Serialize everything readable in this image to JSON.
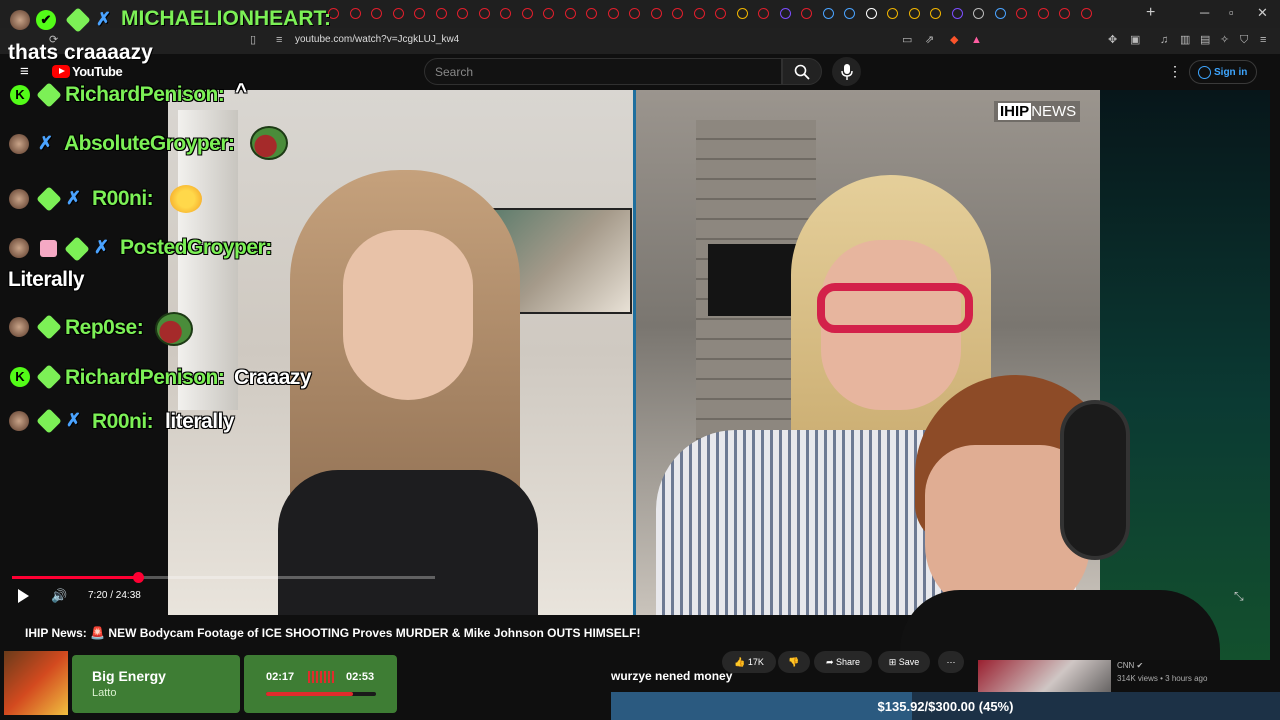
{
  "browser": {
    "url": "youtube.com/watch?v=JcgkLUJ_kw4",
    "new_tab": "+",
    "tab_colors": [
      "#e01f2c",
      "#e01f2c",
      "#e01f2c",
      "#e01f2c",
      "#e01f2c",
      "#e01f2c",
      "#e01f2c",
      "#e01f2c",
      "#e01f2c",
      "#e01f2c",
      "#e01f2c",
      "#e01f2c",
      "#e01f2c",
      "#e01f2c",
      "#e01f2c",
      "#e01f2c",
      "#e01f2c",
      "#e01f2c",
      "#e01f2c",
      "#f0b400",
      "#e01f2c",
      "#7c4dff",
      "#e01f2c",
      "#4aa3ff",
      "#4aa3ff",
      "#ffffff",
      "#f0b400",
      "#f0b400",
      "#f0b400",
      "#7c4dff",
      "#bbbbbb",
      "#4aa3ff",
      "#e01f2c",
      "#e01f2c",
      "#e01f2c",
      "#e01f2c"
    ]
  },
  "youtube": {
    "logo_text": "YouTube",
    "search_placeholder": "Search",
    "sign_in": "Sign in",
    "menu_icon": "hamburger-icon",
    "search_icon": "search-icon",
    "mic_icon": "mic-icon"
  },
  "video": {
    "logo_left": "IHIP",
    "logo_right": "NEWS",
    "time": "7:20 / 24:38",
    "progress_fraction": 0.298,
    "title": "IHIP News: 🚨 NEW Bodycam Footage of ICE SHOOTING Proves MURDER & Mike Johnson OUTS HIMSELF!",
    "likes": "17K",
    "share": "Share",
    "save": "Save",
    "more": "⋯"
  },
  "next_video": {
    "channel": "CNN ✔",
    "meta": "314K views • 3 hours ago"
  },
  "chat": {
    "banner_user": "MICHAELIONHEART:",
    "banner_msg": "thats craaaazy",
    "lines": [
      {
        "user": "RichardPenison:",
        "msg": "^"
      },
      {
        "user": "AbsoluteGroyper:",
        "msg": ""
      },
      {
        "user": "R00ni:",
        "msg": ""
      },
      {
        "user": "PostedGroyper:",
        "msg": "Literally"
      },
      {
        "user": "Rep0se:",
        "msg": ""
      },
      {
        "user": "RichardPenison:",
        "msg": "Craaazy"
      },
      {
        "user": "R00ni:",
        "msg": "literally"
      }
    ]
  },
  "now_playing": {
    "song": "Big Energy",
    "artist": "Latto",
    "elapsed": "02:17",
    "total": "02:53",
    "progress_fraction": 0.79
  },
  "donation": {
    "message": "wurzye nened money",
    "goal_text": "$135.92/$300.00 (45%)",
    "goal_fraction": 0.45
  }
}
